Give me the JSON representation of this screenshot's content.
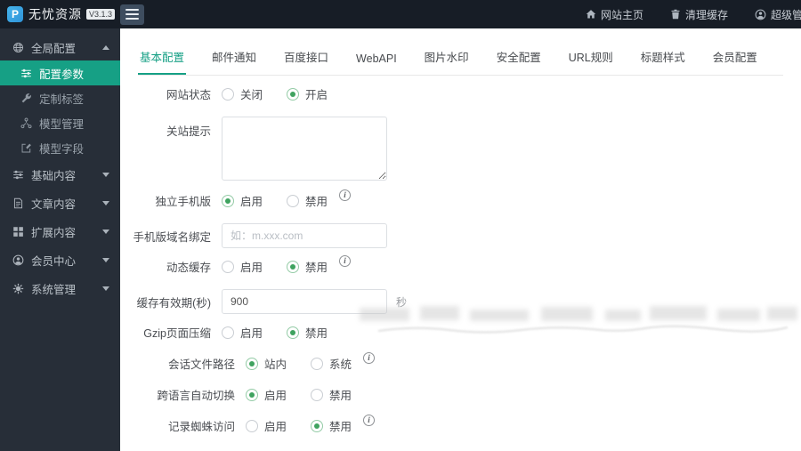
{
  "topbar": {
    "logo_glyph": "P",
    "logo_text": "无忧资源",
    "version_badge": "V3.1.3",
    "actions": [
      {
        "key": "site-home",
        "icon": "home-icon",
        "label": "网站主页"
      },
      {
        "key": "clear-cache",
        "icon": "trash-icon",
        "label": "清理缓存"
      },
      {
        "key": "admin-user",
        "icon": "user-icon",
        "label": "超级管理员"
      }
    ]
  },
  "sidebar": {
    "items": [
      {
        "key": "global-config",
        "level": "section",
        "icon": "globe-icon",
        "label": "全局配置",
        "caret": "up",
        "active": false
      },
      {
        "key": "config-params",
        "level": "sub",
        "icon": "sliders-icon",
        "label": "配置参数",
        "caret": "",
        "active": true
      },
      {
        "key": "custom-tags",
        "level": "sub",
        "icon": "wrench-icon",
        "label": "定制标签",
        "caret": "",
        "active": false
      },
      {
        "key": "model-manage",
        "level": "sub",
        "icon": "nodes-icon",
        "label": "模型管理",
        "caret": "",
        "active": false
      },
      {
        "key": "model-fields",
        "level": "sub",
        "icon": "edit-icon",
        "label": "模型字段",
        "caret": "",
        "active": false
      },
      {
        "key": "base-content",
        "level": "section",
        "icon": "sliders-icon",
        "label": "基础内容",
        "caret": "down",
        "active": false
      },
      {
        "key": "article-content",
        "level": "section",
        "icon": "doc-icon",
        "label": "文章内容",
        "caret": "down",
        "active": false
      },
      {
        "key": "extend-content",
        "level": "section",
        "icon": "grid-icon",
        "label": "扩展内容",
        "caret": "down",
        "active": false
      },
      {
        "key": "member-center",
        "level": "section",
        "icon": "user-icon",
        "label": "会员中心",
        "caret": "down",
        "active": false
      },
      {
        "key": "system-manage",
        "level": "section",
        "icon": "gear-icon",
        "label": "系统管理",
        "caret": "down",
        "active": false
      }
    ]
  },
  "tabs": {
    "active_index": 0,
    "items": [
      {
        "key": "basic-config",
        "label": "基本配置"
      },
      {
        "key": "mail-notify",
        "label": "邮件通知"
      },
      {
        "key": "baidu-api",
        "label": "百度接口"
      },
      {
        "key": "webapi",
        "label": "WebAPI"
      },
      {
        "key": "image-watermark",
        "label": "图片水印"
      },
      {
        "key": "security-config",
        "label": "安全配置"
      },
      {
        "key": "url-rules",
        "label": "URL规则"
      },
      {
        "key": "title-style",
        "label": "标题样式"
      },
      {
        "key": "member-config",
        "label": "会员配置"
      }
    ]
  },
  "form": {
    "rows": [
      {
        "key": "site-status",
        "label": "网站状态",
        "type": "radio",
        "info": false,
        "options": [
          {
            "key": "off",
            "label": "关闭",
            "selected": false
          },
          {
            "key": "on",
            "label": "开启",
            "selected": true
          }
        ]
      },
      {
        "key": "close-tip",
        "label": "关站提示",
        "type": "textarea",
        "value": ""
      },
      {
        "key": "mobile-version",
        "label": "独立手机版",
        "type": "radio",
        "info": true,
        "options": [
          {
            "key": "enable",
            "label": "启用",
            "selected": true
          },
          {
            "key": "disable",
            "label": "禁用",
            "selected": false
          }
        ]
      },
      {
        "key": "mobile-domain",
        "label": "手机版域名绑定",
        "type": "input",
        "value": "",
        "placeholder": "如：m.xxx.com"
      },
      {
        "key": "dynamic-cache",
        "label": "动态缓存",
        "type": "radio",
        "info": true,
        "options": [
          {
            "key": "enable",
            "label": "启用",
            "selected": false
          },
          {
            "key": "disable",
            "label": "禁用",
            "selected": true
          }
        ]
      },
      {
        "key": "cache-expire",
        "label": "缓存有效期(秒)",
        "type": "input",
        "value": "900",
        "placeholder": "",
        "suffix": "秒"
      },
      {
        "key": "gzip-compress",
        "label": "Gzip页面压缩",
        "type": "radio",
        "info": false,
        "options": [
          {
            "key": "enable",
            "label": "启用",
            "selected": false
          },
          {
            "key": "disable",
            "label": "禁用",
            "selected": true
          }
        ]
      },
      {
        "key": "session-path",
        "label": "会话文件路径",
        "type": "radio",
        "info": true,
        "options": [
          {
            "key": "site",
            "label": "站内",
            "selected": true
          },
          {
            "key": "system",
            "label": "系统",
            "selected": false
          }
        ]
      },
      {
        "key": "language-switch",
        "label": "跨语言自动切换",
        "type": "radio",
        "info": false,
        "options": [
          {
            "key": "enable",
            "label": "启用",
            "selected": true
          },
          {
            "key": "disable",
            "label": "禁用",
            "selected": false
          }
        ]
      },
      {
        "key": "spider-log",
        "label": "记录蜘蛛访问",
        "type": "radio",
        "info": true,
        "options": [
          {
            "key": "enable",
            "label": "启用",
            "selected": false
          },
          {
            "key": "disable",
            "label": "禁用",
            "selected": true
          }
        ]
      }
    ]
  },
  "colors": {
    "accent_green": "#16a085",
    "radio_on_green": "#3fa35f",
    "logo_blue": "#38a8e3",
    "topbar_bg": "#171d26",
    "sidebar_bg": "#272e38"
  }
}
